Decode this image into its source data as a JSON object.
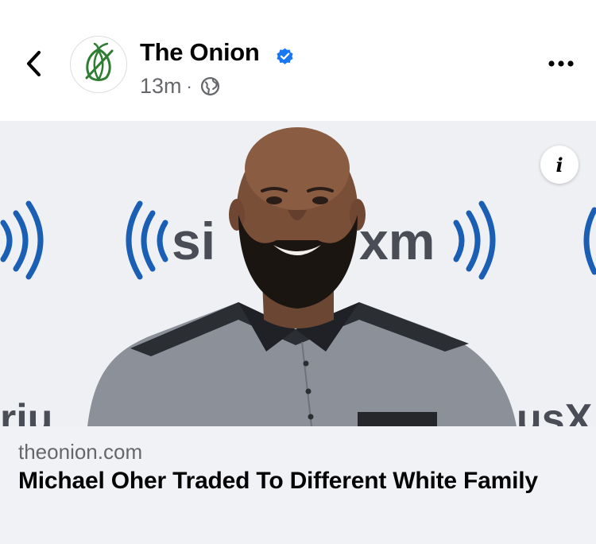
{
  "post": {
    "page_name": "The Onion",
    "verified": true,
    "timestamp": "13m",
    "separator": "·",
    "audience_icon": "globe-icon"
  },
  "media": {
    "backdrop_logo_text_left": "si",
    "backdrop_logo_text_right": "xm",
    "backdrop_bottom_left": "riu",
    "backdrop_bottom_right": "usX",
    "info_label": "i"
  },
  "link": {
    "domain": "theonion.com",
    "headline": "Michael Oher Traded To Different White Family"
  },
  "icons": {
    "back": "chevron-left-icon",
    "more": "more-horizontal-icon",
    "verified": "verified-badge-icon",
    "avatar": "onion-logo-icon"
  },
  "colors": {
    "verified_blue": "#1877f2",
    "secondary_text": "#65676b",
    "link_card_bg": "#f0f2f5",
    "onion_green": "#2e7d32",
    "siriusxm_blue": "#1a5fb4",
    "siriusxm_dark": "#4a4d55"
  }
}
